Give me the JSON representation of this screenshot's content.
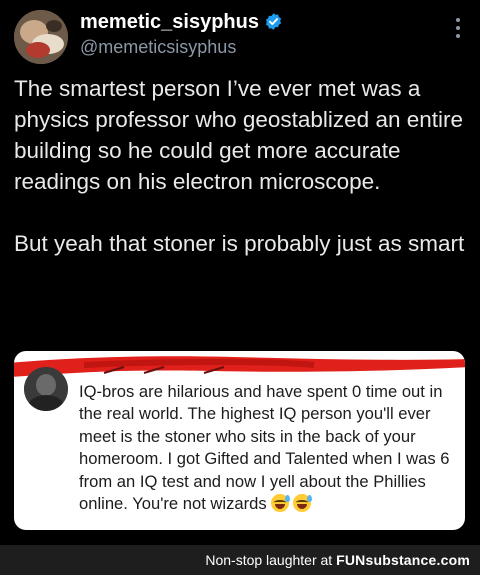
{
  "tweet": {
    "display_name": "memetic_sisyphus",
    "handle": "@memeticsisyphus",
    "paragraph_1": "The smartest person I’ve ever met was a physics professor who geostablized an entire building so he could get more accurate readings on his electron microscope.",
    "paragraph_2": "But yeah that stoner is probably just as smart",
    "icons": [
      "avatar",
      "verified-badge-icon",
      "more-options-icon"
    ]
  },
  "quoted_post": {
    "text": "IQ-bros are hilarious and have spent 0 time out in the real world. The highest IQ person you'll ever meet is the stoner who sits in the back of your homeroom. I got Gifted and Talented when I was 6 from an IQ test and now I yell about the Phillies online. You're not wizards",
    "emoji": [
      "grinning-sweat-emoji",
      "grinning-sweat-emoji"
    ]
  },
  "footer": {
    "caption": "Non-stop laughter at",
    "brand": "FUNsubstance.com"
  },
  "colors": {
    "background": "#000000",
    "primary_text": "#e7e9ea",
    "secondary_text": "#8b98a5",
    "verified_blue": "#1d9bf0",
    "redaction_red": "#e0201b",
    "footer_bar": "#1e1e1e"
  }
}
